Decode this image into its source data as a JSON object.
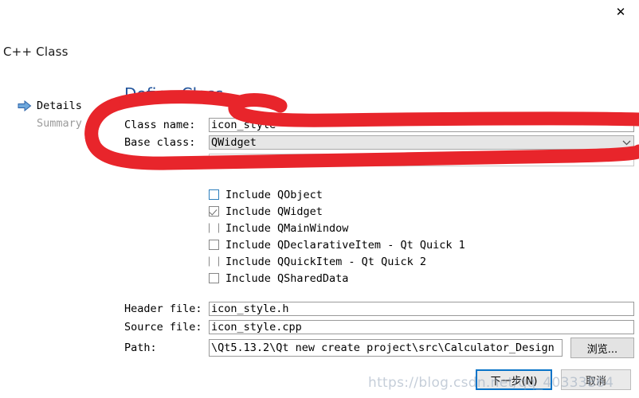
{
  "window": {
    "title": "C++ Class",
    "close_icon": "close-icon"
  },
  "nav": {
    "items": [
      {
        "label": "Details",
        "active": true,
        "icon": "blue-arrow-icon"
      },
      {
        "label": "Summary",
        "active": false,
        "icon": ""
      }
    ]
  },
  "page": {
    "heading": "Define Class"
  },
  "form": {
    "class_name": {
      "label": "Class name:",
      "value": "icon_style"
    },
    "base_class": {
      "label": "Base class:",
      "value": "QWidget",
      "chevron_icon": "chevron-down-icon"
    }
  },
  "includes": [
    {
      "label": "Include QObject",
      "checked": false,
      "state": "hover"
    },
    {
      "label": "Include QWidget",
      "checked": true,
      "state": "normal"
    },
    {
      "label": "Include QMainWindow",
      "checked": false,
      "state": "sparse"
    },
    {
      "label": "Include QDeclarativeItem - Qt Quick 1",
      "checked": false,
      "state": "normal"
    },
    {
      "label": "Include QQuickItem - Qt Quick 2",
      "checked": false,
      "state": "sparse"
    },
    {
      "label": "Include QSharedData",
      "checked": false,
      "state": "normal"
    }
  ],
  "files": {
    "header_file": {
      "label": "Header file:",
      "value": "icon_style.h"
    },
    "source_file": {
      "label": "Source file:",
      "value": "icon_style.cpp"
    },
    "path": {
      "label": "Path:",
      "value": "\\Qt5.13.2\\Qt new create project\\src\\Calculator_Design"
    },
    "browse_button": "浏览..."
  },
  "footer": {
    "next_button": "下一步(N)",
    "cancel_button": "取消"
  },
  "watermark": "https://blog.csdn.net/qq_40333864",
  "colors": {
    "annotation_red": "#E8252B",
    "heading_blue": "#21549C",
    "focus_blue": "#0A74C8"
  }
}
